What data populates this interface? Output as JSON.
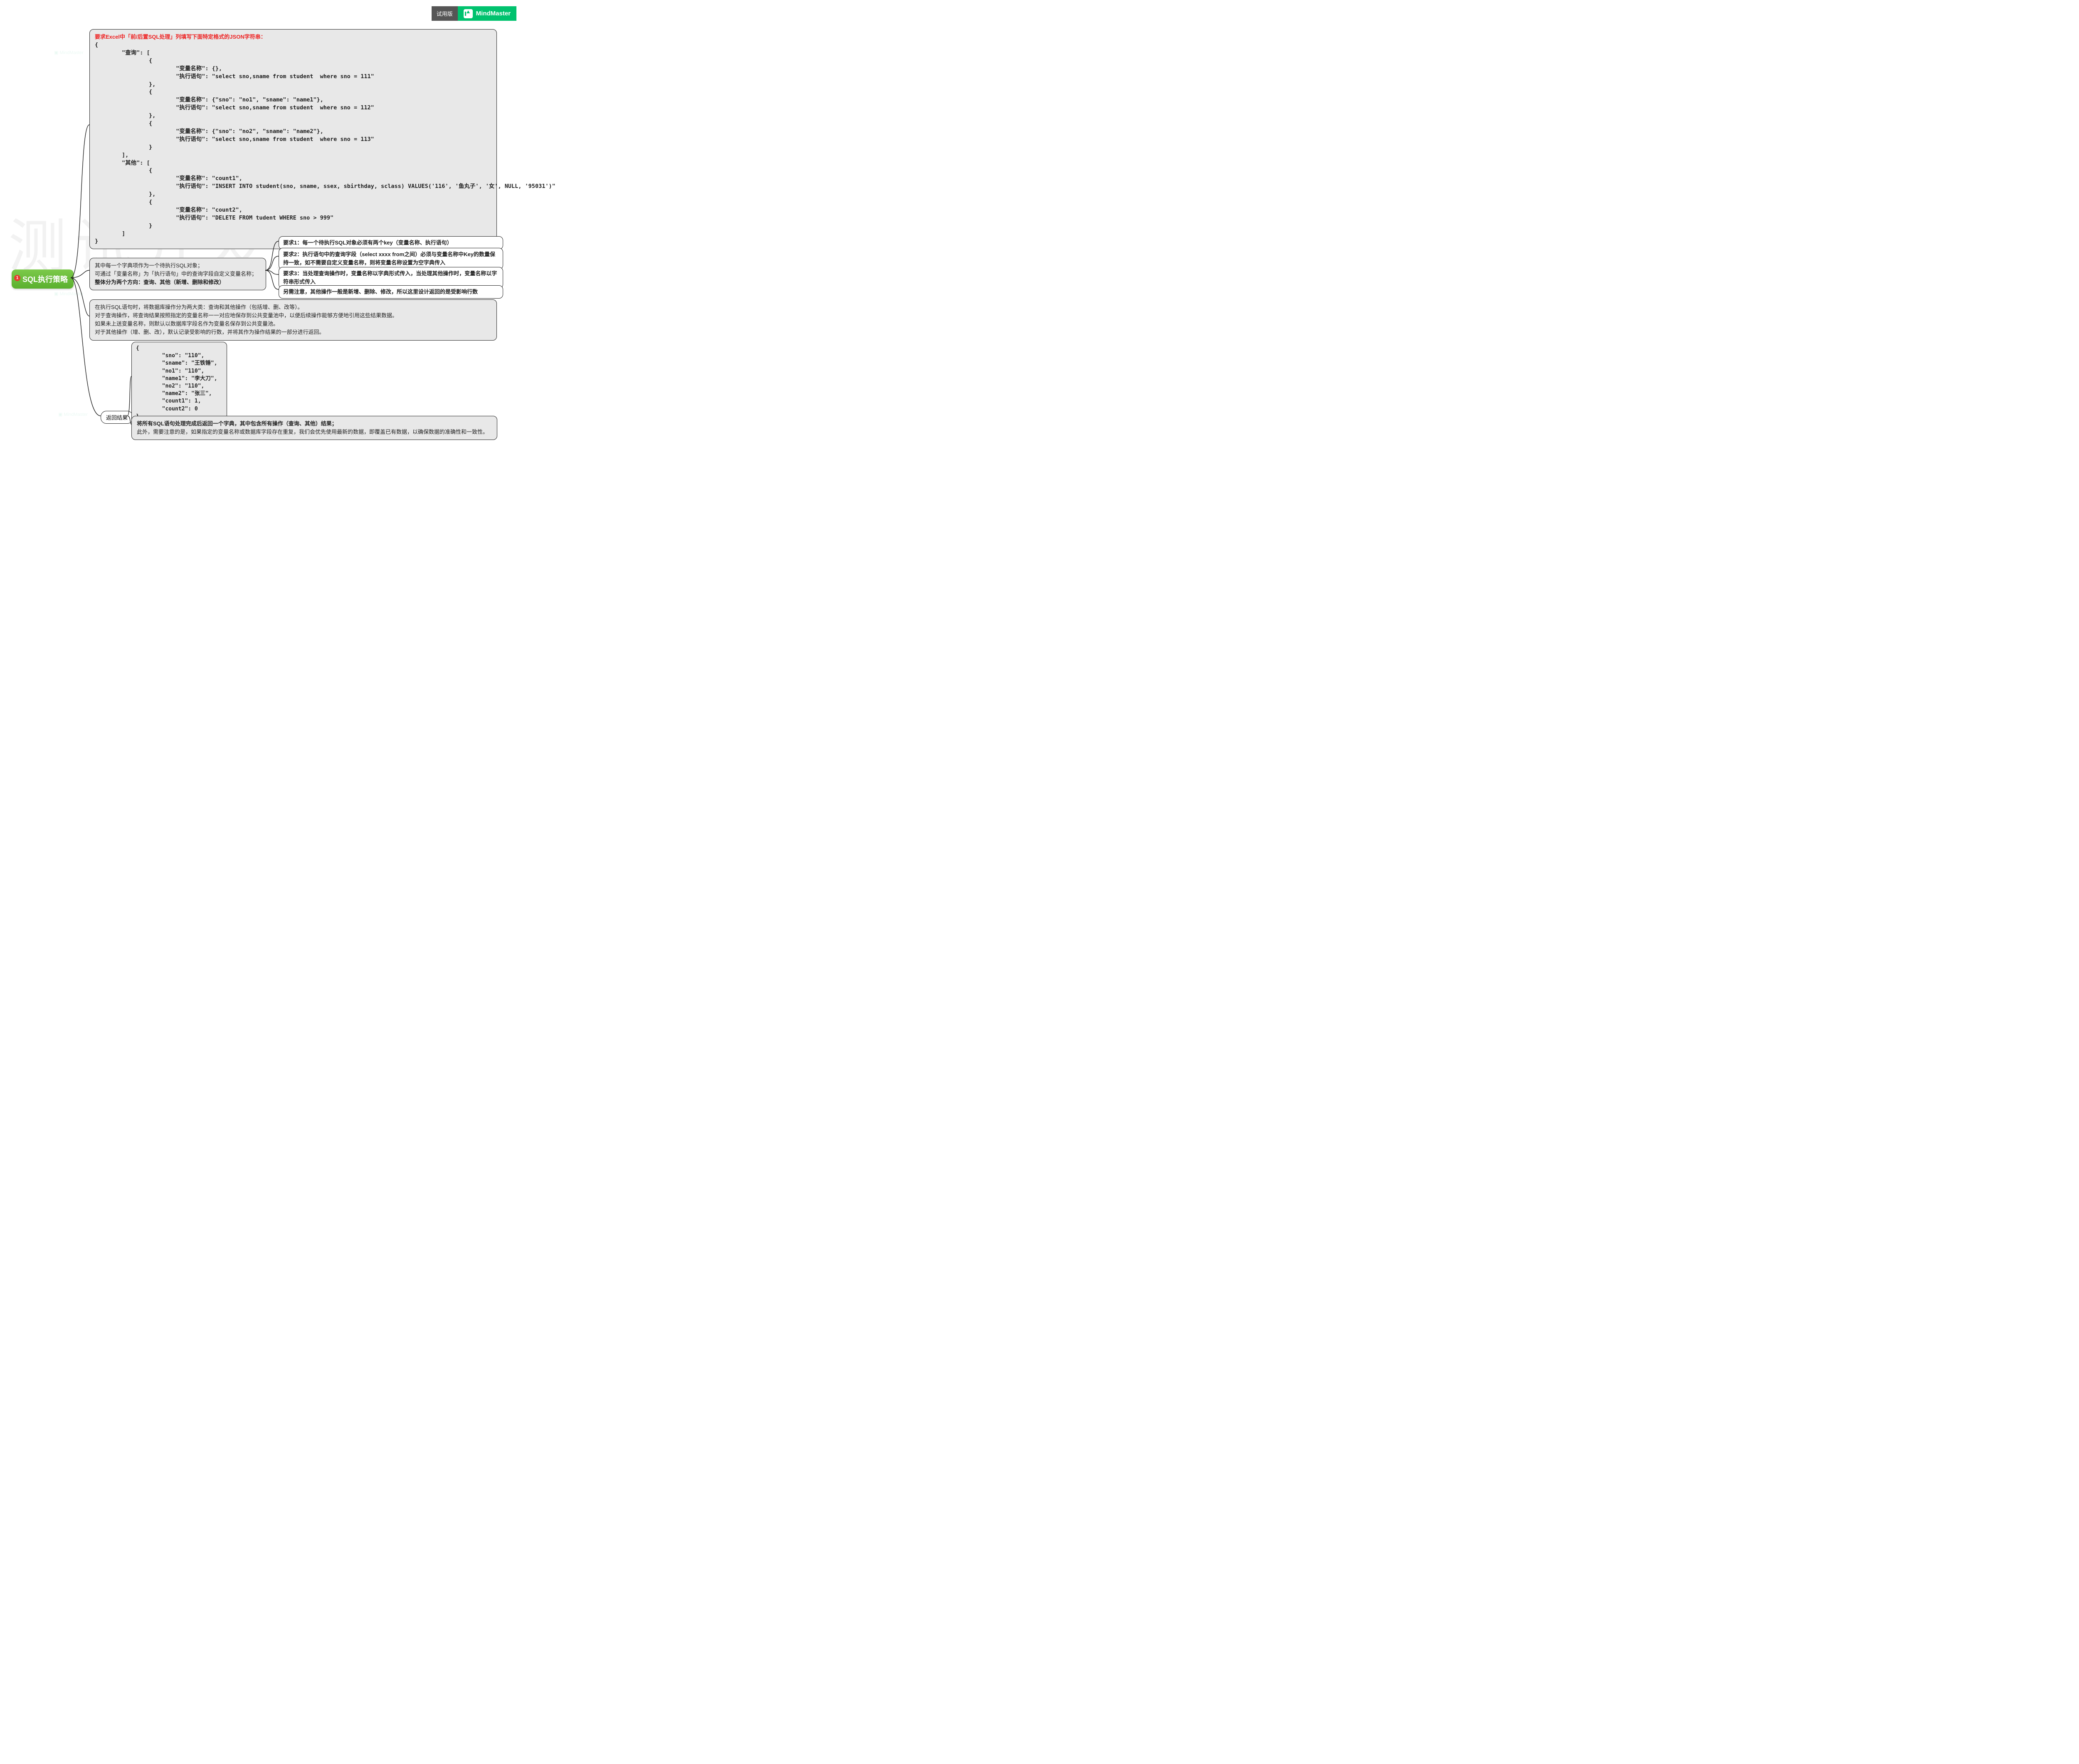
{
  "header": {
    "trial_label": "试用版",
    "brand": "MindMaster"
  },
  "watermark_large": "测试开发数据网",
  "root": {
    "badge": "1",
    "label": "SQL执行策略"
  },
  "json_spec": {
    "title": "要求Excel中「前/后置SQL处理」列填写下面特定格式的JSON字符串：",
    "body": "{\n        \"查询\": [\n                {\n                        \"变量名称\": {},\n                        \"执行语句\": \"select sno,sname from student  where sno = 111\"\n                },\n                {\n                        \"变量名称\": {\"sno\": \"no1\", \"sname\": \"name1\"},\n                        \"执行语句\": \"select sno,sname from student  where sno = 112\"\n                },\n                {\n                        \"变量名称\": {\"sno\": \"no2\", \"sname\": \"name2\"},\n                        \"执行语句\": \"select sno,sname from student  where sno = 113\"\n                }\n        ],\n        \"其他\": [\n                {\n                        \"变量名称\": \"count1\",\n                        \"执行语句\": \"INSERT INTO student(sno, sname, ssex, sbirthday, sclass) VALUES('116', '鱼丸子', '女', NULL, '95031')\"\n                },\n                {\n                        \"变量名称\": \"count2\",\n                        \"执行语句\": \"DELETE FROM tudent WHERE sno > 999\"\n                }\n        ]\n}"
  },
  "object_desc": {
    "line1": "其中每一个字典项作为一个待执行SQL对象；",
    "line2": "可通过「变量名称」为「执行语句」中的查询字段自定义变量名称；",
    "line3": "整体分为两个方向：查询、其他（新增、删除和修改）"
  },
  "requirements": {
    "r1": "要求1：每一个待执行SQL对象必须有两个key（变量名称、执行语句）",
    "r2": "要求2：执行语句中的查询字段（select xxxx from之间）必须与变量名称中Key的数量保持一致，如不需要自定义变量名称，则将变量名称设置为空字典传入",
    "r3": "要求3：当处理查询操作时，变量名称以字典形式传入，当处理其他操作时，变量名称以字符串形式传入",
    "note": "另需注意，其他操作一般是新增、删除、修改，所以这里设计返回的是受影响行数"
  },
  "execution_desc": {
    "l1": "在执行SQL语句时，将数据库操作分为两大类：查询和其他操作（包括增、删、改等）。",
    "l2": "对于查询操作，将查询结果按照指定的变量名称一一对应地保存到公共变量池中，以便后续操作能够方便地引用这些结果数据。",
    "l3": "如果未上送变量名称，则默认以数据库字段名作为变量名保存到公共变量池。",
    "l4": "对于其他操作（增、删、改），默认记录受影响的行数，并将其作为操作结果的一部分进行返回。"
  },
  "return_node": {
    "label": "返回结果"
  },
  "return_json": {
    "body": "{\n        \"sno\": \"110\",\n        \"sname\": \"王铁锤\",\n        \"no1\": \"110\",\n        \"name1\": \"李大刀\",\n        \"no2\": \"110\",\n        \"name2\": \"张三\",\n        \"count1\": 1,\n        \"count2\": 0\n}"
  },
  "return_desc": {
    "l1": "将所有SQL语句处理完成后返回一个字典，其中包含所有操作（查询、其他）结果；",
    "l2": "此外，需要注意的是，如果指定的变量名称或数据库字段存在重复，我们会优先使用最新的数据，即覆盖已有数据，以确保数据的准确性和一致性。"
  }
}
